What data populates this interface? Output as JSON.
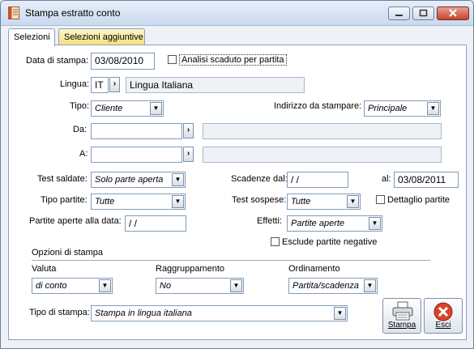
{
  "window": {
    "title": "Stampa estratto conto"
  },
  "tabs": [
    {
      "label": "Selezioni"
    },
    {
      "label": "Selezioni aggiuntive"
    }
  ],
  "form": {
    "data_stampa": {
      "label": "Data di stampa:",
      "value": "03/08/2010"
    },
    "analisi_scaduto": {
      "label": "Analisi scaduto per partita",
      "checked": false
    },
    "lingua": {
      "label": "Lingua:",
      "code": "IT",
      "description": "Lingua Italiana"
    },
    "tipo": {
      "label": "Tipo:",
      "value": "Cliente"
    },
    "indirizzo": {
      "label": "Indirizzo da stampare:",
      "value": "Principale"
    },
    "da": {
      "label": "Da:",
      "code": "",
      "description": ""
    },
    "a": {
      "label": "A:",
      "code": "",
      "description": ""
    },
    "test_saldate": {
      "label": "Test saldate:",
      "value": "Solo parte aperta"
    },
    "scadenze_dal": {
      "label": "Scadenze dal:",
      "value": " /  /"
    },
    "scadenze_al": {
      "label": "al:",
      "value": "03/08/2011"
    },
    "tipo_partite": {
      "label": "Tipo partite:",
      "value": "Tutte"
    },
    "test_sospese": {
      "label": "Test sospese:",
      "value": "Tutte"
    },
    "dettaglio_partite": {
      "label": "Dettaglio partite",
      "checked": false
    },
    "partite_aperte_data": {
      "label": "Partite aperte alla data:",
      "value": " /  /"
    },
    "effetti": {
      "label": "Effetti:",
      "value": "Partite aperte"
    },
    "esclude_negative": {
      "label": "Esclude partite negative",
      "checked": false
    }
  },
  "opzioni": {
    "title": "Opzioni di stampa",
    "valuta": {
      "label": "Valuta",
      "value": "di conto"
    },
    "raggruppamento": {
      "label": "Raggruppamento",
      "value": "No"
    },
    "ordinamento": {
      "label": "Ordinamento",
      "value": "Partita/scadenza"
    },
    "tipo_stampa": {
      "label": "Tipo di stampa:",
      "value": "Stampa in lingua italiana"
    }
  },
  "buttons": {
    "stampa": {
      "label": "Stampa",
      "icon": "printer-icon"
    },
    "esci": {
      "label": "Esci",
      "icon": "close-icon"
    }
  },
  "colors": {
    "active_tab": "#ffffff",
    "inactive_tab": "#f5df7a",
    "close_button": "#c3452b",
    "readonly_field": "#eef1f6"
  }
}
